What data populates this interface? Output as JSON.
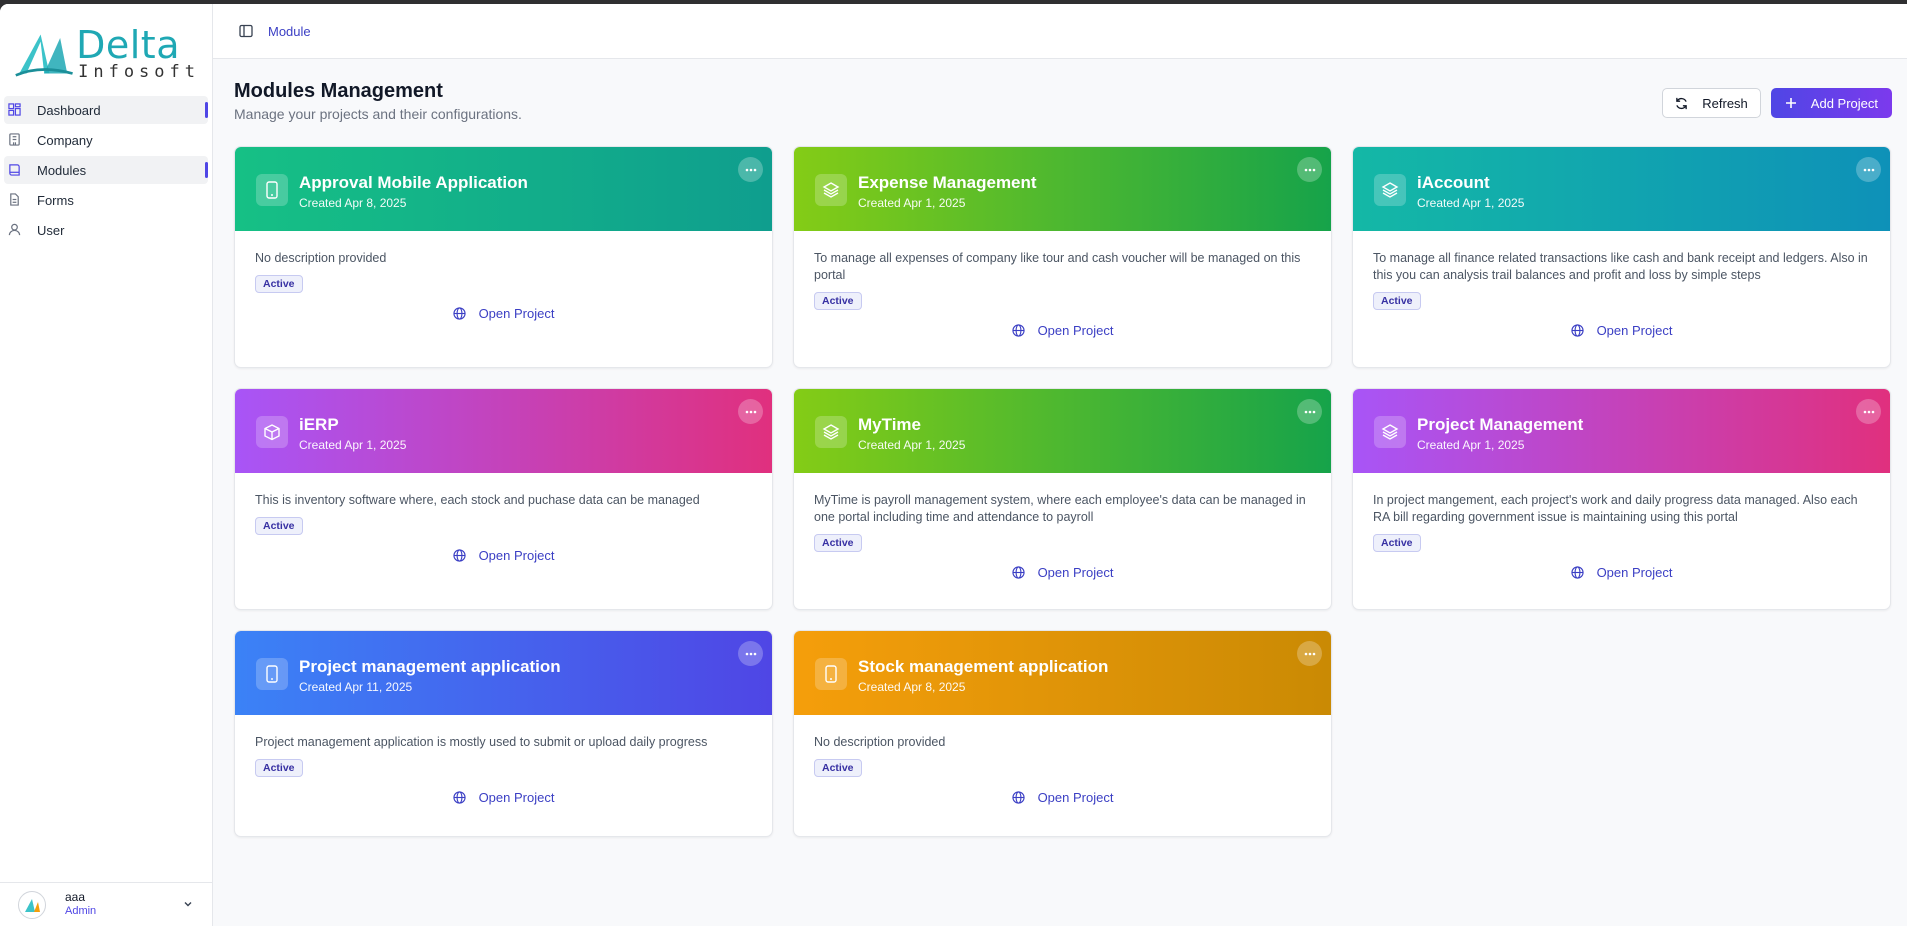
{
  "sidebar": {
    "logo": {
      "name": "Delta",
      "sub": "Infosoft"
    },
    "items": [
      {
        "label": "Dashboard",
        "icon": "dashboard-icon",
        "active": true
      },
      {
        "label": "Company",
        "icon": "building-icon",
        "active": false
      },
      {
        "label": "Modules",
        "icon": "book-icon",
        "active": true
      },
      {
        "label": "Forms",
        "icon": "file-icon",
        "active": false
      },
      {
        "label": "User",
        "icon": "user-icon",
        "active": false
      }
    ],
    "user": {
      "name": "aaa",
      "role": "Admin"
    }
  },
  "header": {
    "breadcrumb": "Module"
  },
  "page": {
    "title": "Modules Management",
    "subtitle": "Manage your projects and their configurations.",
    "refresh_label": "Refresh",
    "add_label": "Add Project"
  },
  "cards": [
    {
      "title": "Approval Mobile Application",
      "date": "Created Apr 8, 2025",
      "description": "No description provided",
      "status": "Active",
      "action": "Open Project",
      "icon": "smartphone-icon",
      "colors": [
        "#16c085",
        "#0f9e8e"
      ]
    },
    {
      "title": "Expense Management",
      "date": "Created Apr 1, 2025",
      "description": "To manage all expenses of company like tour and cash voucher will be managed on this portal",
      "status": "Active",
      "action": "Open Project",
      "icon": "layers-icon",
      "colors": [
        "#84cc16",
        "#16a34a"
      ]
    },
    {
      "title": "iAccount",
      "date": "Created Apr 1, 2025",
      "description": "To manage all finance related transactions like cash and bank receipt and ledgers. Also in this you can analysis trail balances and profit and loss by simple steps",
      "status": "Active",
      "action": "Open Project",
      "icon": "layers-icon",
      "colors": [
        "#14b8a6",
        "#0e91b8"
      ]
    },
    {
      "title": "iERP",
      "date": "Created Apr 1, 2025",
      "description": "This is inventory software where, each stock and puchase data can be managed",
      "status": "Active",
      "action": "Open Project",
      "icon": "box-icon",
      "colors": [
        "#a855f7",
        "#e0307e"
      ]
    },
    {
      "title": "MyTime",
      "date": "Created Apr 1, 2025",
      "description": "MyTime is payroll management system, where each employee's data can be managed in one portal including time and attendance to payroll",
      "status": "Active",
      "action": "Open Project",
      "icon": "layers-icon",
      "colors": [
        "#84cc16",
        "#16a34a"
      ]
    },
    {
      "title": "Project Management",
      "date": "Created Apr 1, 2025",
      "description": "In project mangement, each project's work and daily progress data managed. Also each RA bill regarding government issue is maintaining using this portal",
      "status": "Active",
      "action": "Open Project",
      "icon": "layers-icon",
      "colors": [
        "#a855f7",
        "#e0307e"
      ]
    },
    {
      "title": "Project management application",
      "date": "Created Apr 11, 2025",
      "description": "Project management application is mostly used to submit or upload daily progress",
      "status": "Active",
      "action": "Open Project",
      "icon": "smartphone-icon",
      "colors": [
        "#3b82f6",
        "#4f46e5"
      ]
    },
    {
      "title": "Stock management application",
      "date": "Created Apr 8, 2025",
      "description": "No description provided",
      "status": "Active",
      "action": "Open Project",
      "icon": "smartphone-icon",
      "colors": [
        "#f59e0b",
        "#ca8a04"
      ]
    }
  ]
}
